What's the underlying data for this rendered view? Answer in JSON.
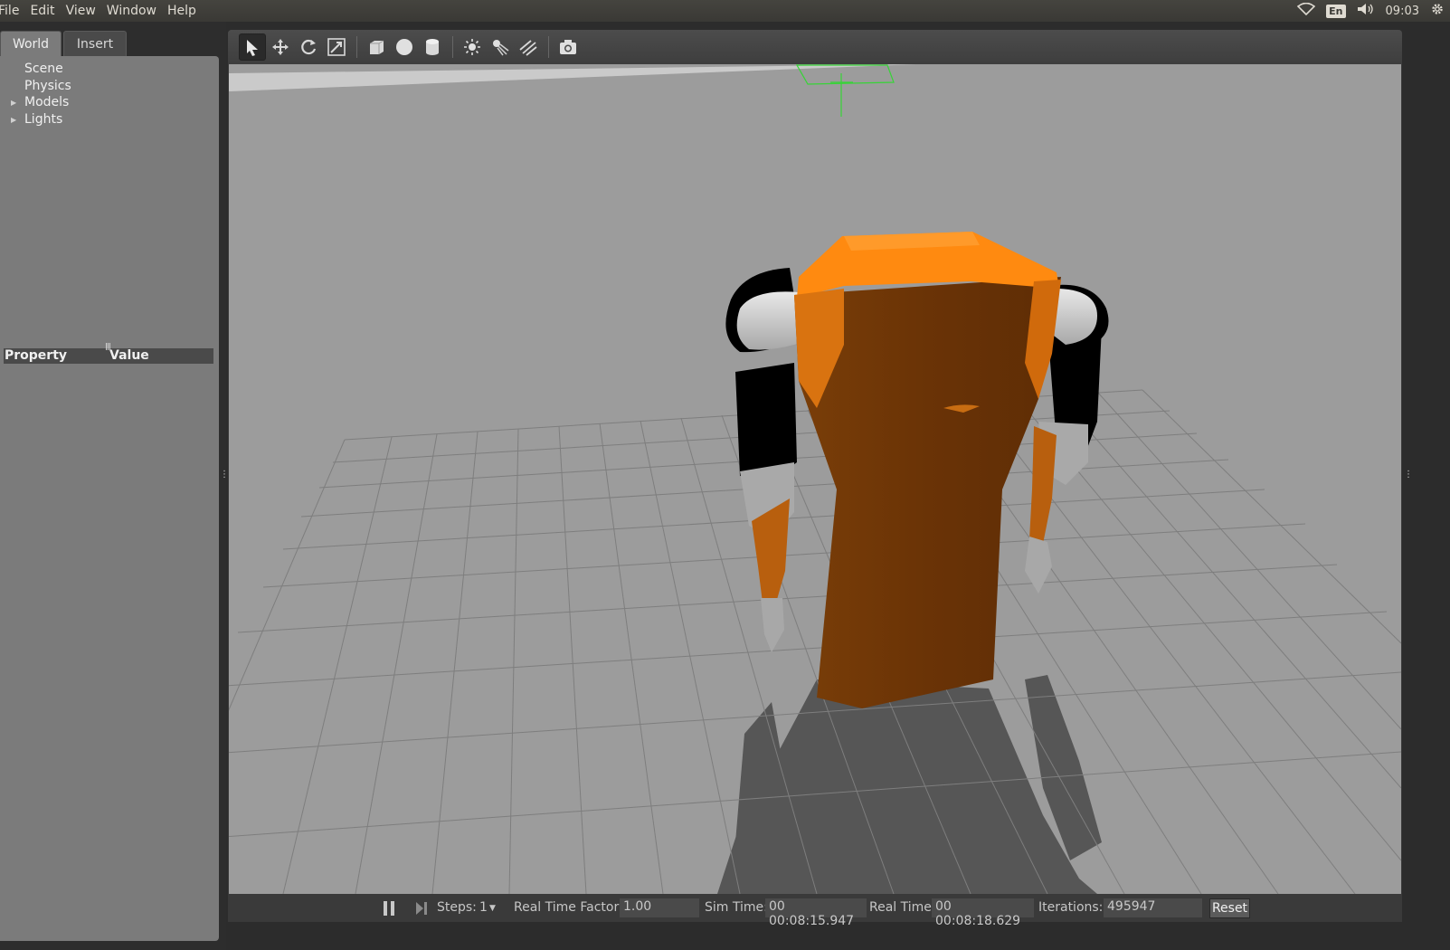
{
  "menubar": {
    "items": [
      "File",
      "Edit",
      "View",
      "Window",
      "Help"
    ]
  },
  "tray": {
    "keyboard": "En",
    "clock": "09:03",
    "icons": [
      "wifi-icon",
      "volume-icon",
      "gear-icon"
    ]
  },
  "left_panel": {
    "tabs": [
      "World",
      "Insert"
    ],
    "tree": [
      "Scene",
      "Physics",
      "Models",
      "Lights"
    ],
    "property_header": {
      "property": "Property",
      "value": "Value"
    }
  },
  "toolbar": {
    "tools": [
      "select-arrow-icon",
      "translate-icon",
      "rotate-icon",
      "scale-icon",
      "box-shape-icon",
      "sphere-shape-icon",
      "cylinder-shape-icon",
      "point-light-icon",
      "spot-light-icon",
      "directional-light-icon",
      "screenshot-icon"
    ]
  },
  "statusbar": {
    "steps_label": "Steps:",
    "steps_value": "1",
    "rtf_label": "Real Time Factor:",
    "rtf_value": "1.00",
    "sim_time_label": "Sim Time:",
    "sim_time_value": "00 00:08:15.947",
    "real_time_label": "Real Time:",
    "real_time_value": "00 00:08:18.629",
    "iterations_label": "Iterations:",
    "iterations_value": "495947",
    "reset_label": "Reset"
  },
  "colors": {
    "robot_orange": "#ff8a10",
    "robot_body": "#6b3507",
    "ground": "#9c9c9c",
    "grid": "#7e7e7e",
    "shadow": "#565656"
  }
}
